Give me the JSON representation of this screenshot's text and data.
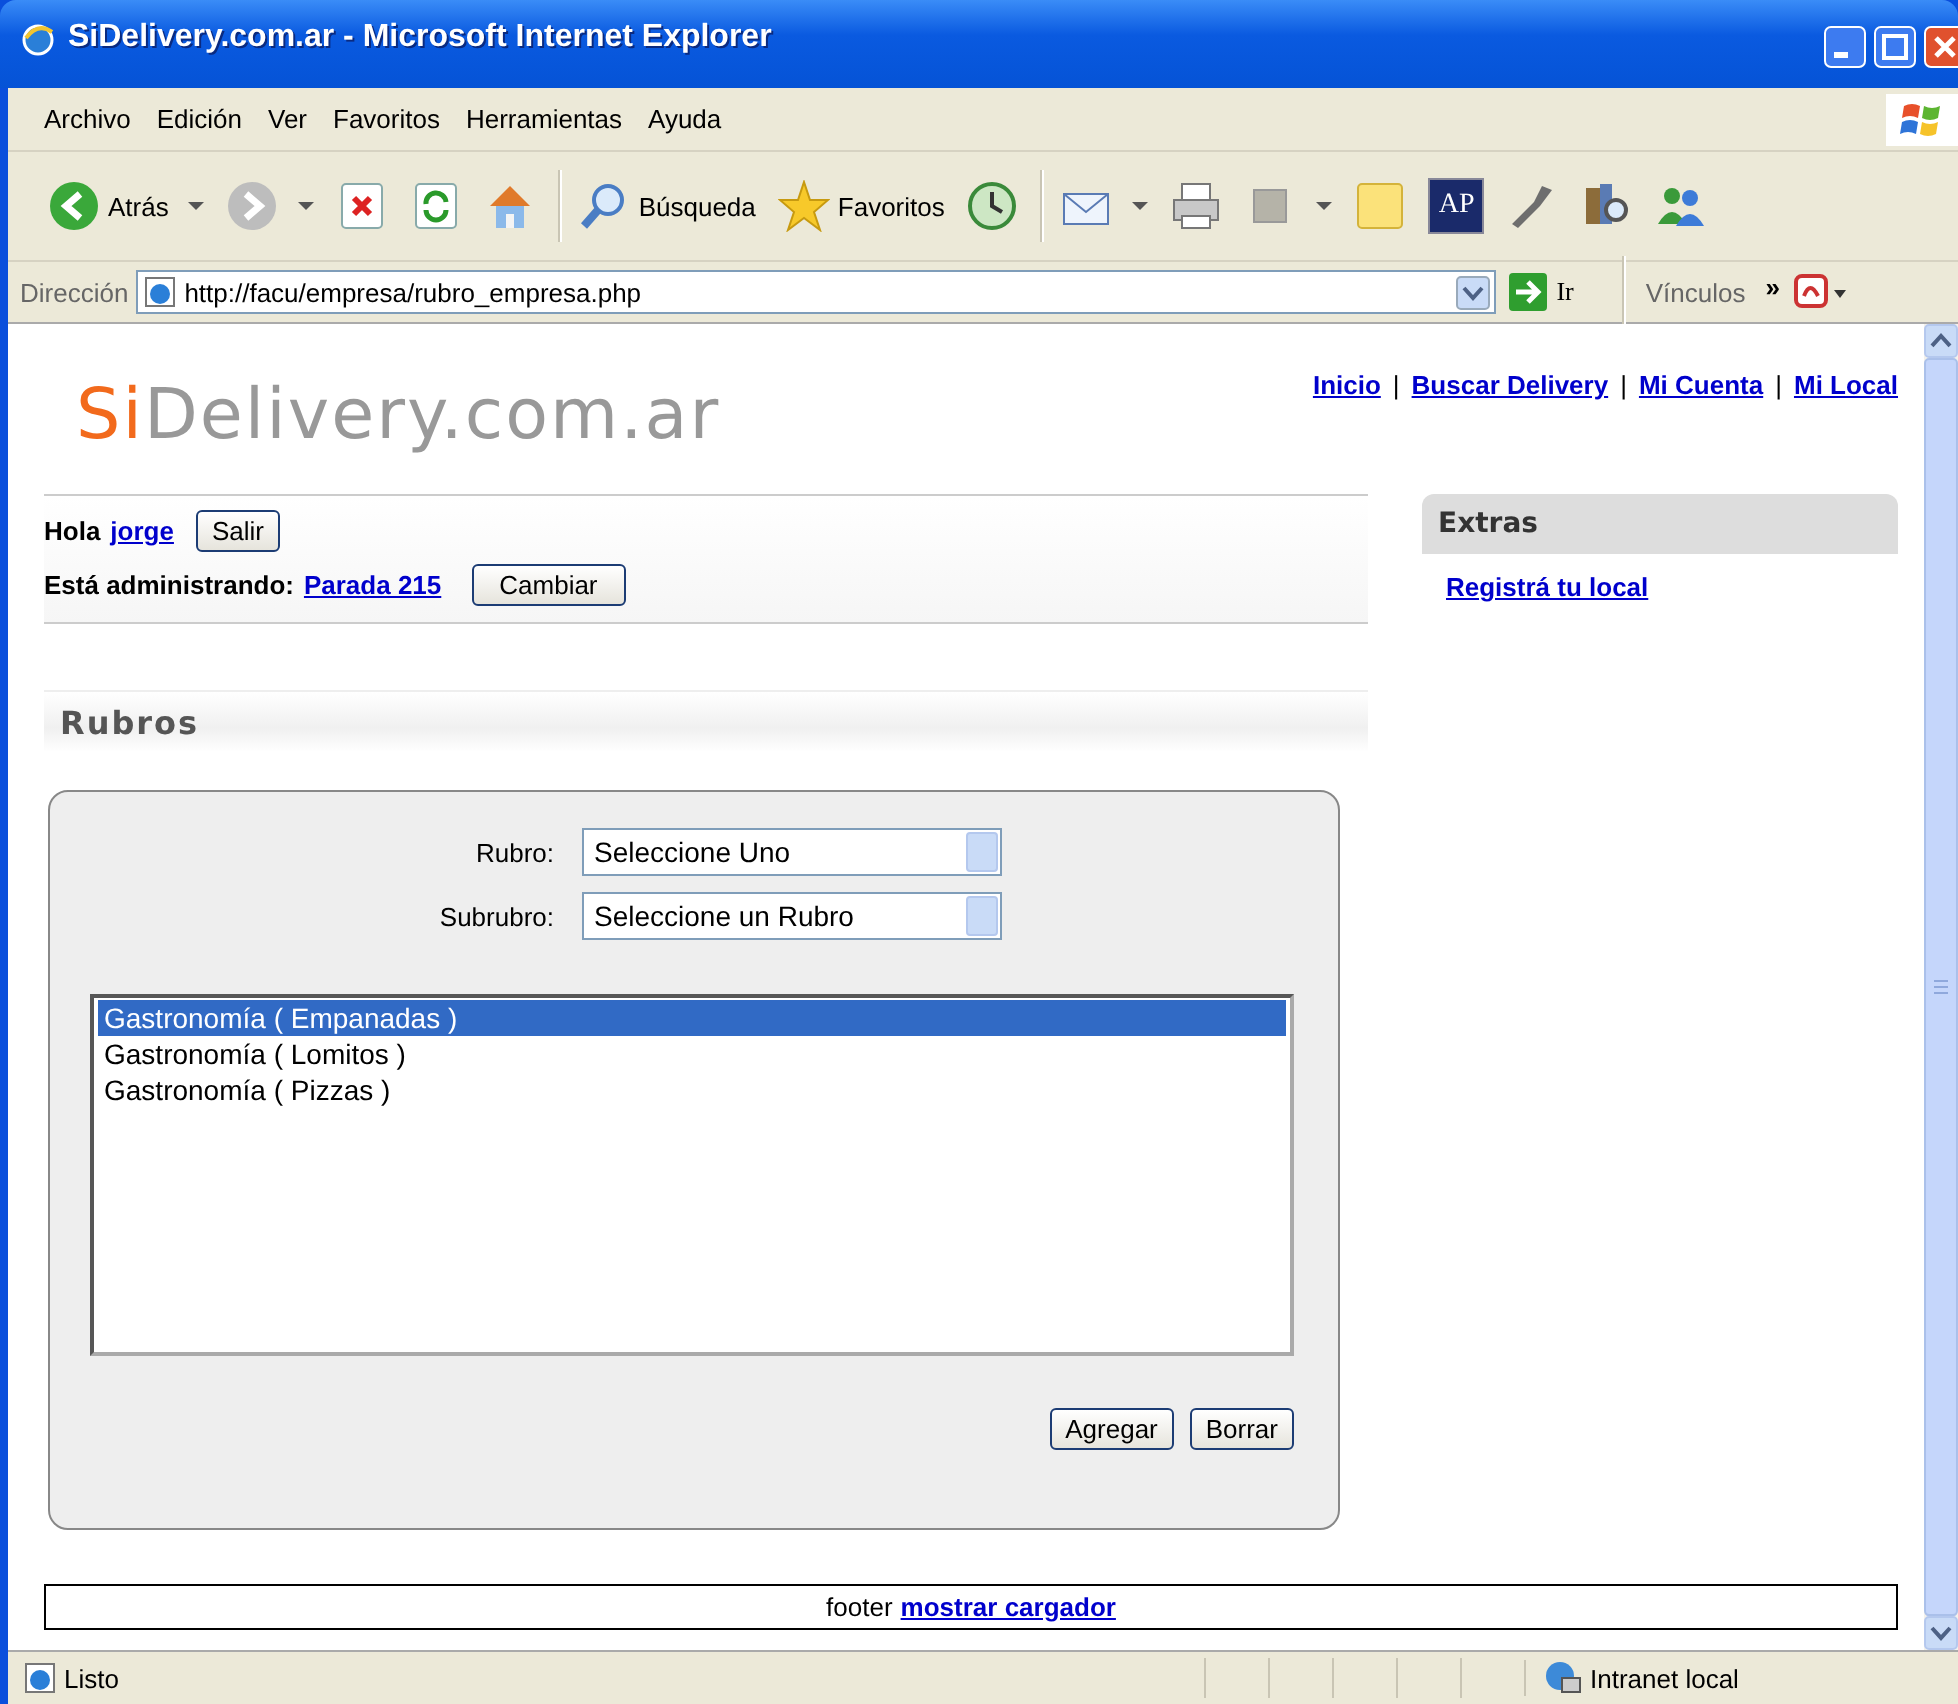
{
  "window": {
    "title": "SiDelivery.com.ar - Microsoft Internet Explorer"
  },
  "menu": [
    "Archivo",
    "Edición",
    "Ver",
    "Favoritos",
    "Herramientas",
    "Ayuda"
  ],
  "toolbar": [
    {
      "kind": "back",
      "label": "Atrás"
    },
    {
      "kind": "forward"
    },
    {
      "kind": "stop"
    },
    {
      "kind": "refresh"
    },
    {
      "kind": "home"
    },
    {
      "kind": "search",
      "label": "Búsqueda"
    },
    {
      "kind": "favorites",
      "label": "Favoritos"
    },
    {
      "kind": "history"
    },
    {
      "kind": "mail"
    },
    {
      "kind": "print"
    },
    {
      "kind": "edit"
    },
    {
      "kind": "note"
    },
    {
      "kind": "badge",
      "label": "AP"
    },
    {
      "kind": "tool"
    },
    {
      "kind": "research"
    },
    {
      "kind": "people"
    }
  ],
  "address_bar": {
    "label": "Dirección",
    "url": "http://facu/empresa/rubro_empresa.php",
    "go": "Ir",
    "links": "Vínculos",
    "more": "»"
  },
  "page": {
    "logo": {
      "accent": "Si",
      "rest": "Delivery.com.ar"
    },
    "nav": [
      "Inicio",
      "Buscar Delivery",
      "Mi Cuenta",
      "Mi Local"
    ],
    "nav_separator": "|",
    "user": {
      "greeting": "Hola",
      "name": "jorge",
      "logout": "Salir"
    },
    "admin": {
      "label": "Está administrando:",
      "store": "Parada 215",
      "button": "Cambiar"
    },
    "section_title": "Rubros",
    "fields": [
      {
        "label": "Rubro:",
        "value": "Seleccione Uno"
      },
      {
        "label": "Subrubro:",
        "value": "Seleccione un Rubro"
      }
    ],
    "list": [
      {
        "text": "Gastronomía ( Empanadas )",
        "selected": true
      },
      {
        "text": "Gastronomía ( Lomitos )",
        "selected": false
      },
      {
        "text": "Gastronomía ( Pizzas )",
        "selected": false
      }
    ],
    "buttons": [
      "Agregar",
      "Borrar"
    ],
    "extras": {
      "title": "Extras",
      "links": [
        "Registrá tu local"
      ]
    },
    "footer": {
      "text": "footer",
      "link": "mostrar cargador"
    }
  },
  "status_bar": {
    "text": "Listo",
    "zone": "Intranet local"
  }
}
